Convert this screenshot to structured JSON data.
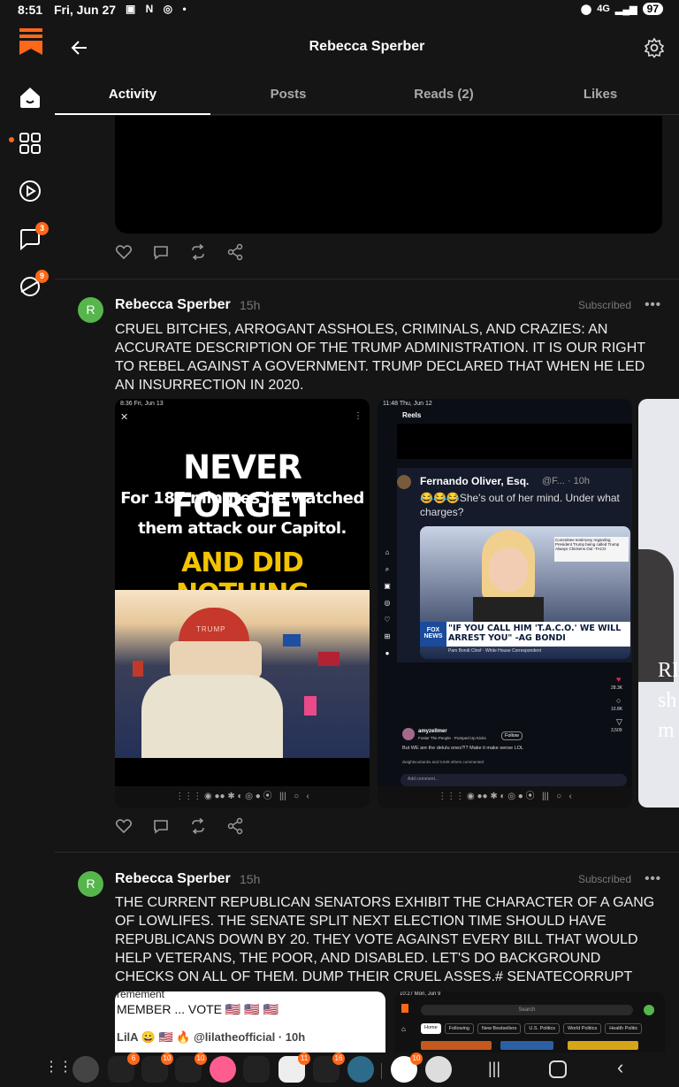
{
  "status_bar": {
    "time": "8:51",
    "date": "Fri, Jun 27",
    "signal": "4G",
    "battery": "97"
  },
  "rail": {
    "chat_badge": "3",
    "activity_badge": "9"
  },
  "header": {
    "title": "Rebecca Sperber"
  },
  "tabs": [
    {
      "label": "Activity",
      "active": true
    },
    {
      "label": "Posts",
      "active": false
    },
    {
      "label": "Reads (2)",
      "active": false
    },
    {
      "label": "Likes",
      "active": false
    }
  ],
  "posts": [
    {
      "avatar_letter": "R",
      "author": "Rebecca Sperber",
      "age": "15h",
      "status": "Subscribed",
      "text": "CRUEL BITCHES, ARROGANT ASSHOLES, CRIMINALS, AND CRAZIES: AN ACCURATE DESCRIPTION OF THE TRUMP ADMINISTRATION. IT IS OUR RIGHT TO REBEL AGAINST A GOVERNMENT. TRUMP DECLARED THAT WHEN HE LED AN INSURRECTION IN 2020.",
      "image1": {
        "topbar": "8:36 Fri, Jun 13",
        "line1": "NEVER FORGET",
        "line2": "For 187 minutes he watched",
        "line3": "them attack our Capitol.",
        "line4": "AND DID NOTHING",
        "hat": "TRUMP"
      },
      "image2": {
        "topbar": "11:48 Thu, Jun 12",
        "header": "Reels",
        "tweet_author": "Fernando Oliver, Esq.",
        "tweet_handle": "@F... · 10h",
        "tweet_text": "😂😂😂She's out of her mind. Under what charges?",
        "chyron_tag": "Committee testimony regarding President Trump being called Trump Always Chickens Out -TACO",
        "network": "FOX NEWS",
        "chyron": "\"IF YOU CALL HIM 'T.A.C.O.' WE WILL ARREST YOU\" -AG BONDI",
        "chyron_sub": "Pam Bondi Chief · White House Correspondent",
        "side_counts": [
          "28.3K",
          "10.8K",
          "3,509"
        ],
        "commenter": "amyzellmer",
        "commenter_sub": "Foster The People · Pumped Up Kicks",
        "follow_label": "Follow",
        "comment_text": "But WE are the delulu ones?!? Make it make sense LOL",
        "liked_by": "dwightsoubanks and 9,949 others commented",
        "comment_placeholder": "Add comment..."
      },
      "image3_text": "RI sh m"
    },
    {
      "avatar_letter": "R",
      "author": "Rebecca Sperber",
      "age": "15h",
      "status": "Subscribed",
      "text": "THE CURRENT REPUBLICAN SENATORS EXHIBIT THE CHARACTER OF A GANG OF LOWLIFES. THE SENATE SPLIT NEXT ELECTION TIME SHOULD HAVE REPUBLICANS DOWN BY 20. THEY VOTE AGAINST EVERY BILL THAT WOULD HELP VETERANS, THE POOR, AND DISABLED. LET'S DO BACKGROUND CHECKS ON ALL OF THEM. DUMP THEIR CRUEL ASSES.# SENATECORRUPT",
      "thumb1_line1": "remement",
      "thumb1_line2": "MEMBER ... VOTE 🇺🇸 🇺🇸 🇺🇸",
      "thumb1_line3": "LilA 😀 🇺🇸 🔥  @lilatheofficial  · 10h",
      "thumb2_topbar": "10:27 Mon, Jun 9",
      "thumb2_search": "Search",
      "thumb2_tabs": [
        "Home",
        "Following",
        "New Bestsellers",
        "U.S. Politics",
        "World Politics",
        "Health Politic"
      ]
    }
  ],
  "navbar": {
    "badges": [
      "6",
      "10",
      "10",
      "11",
      "16",
      "10"
    ]
  }
}
